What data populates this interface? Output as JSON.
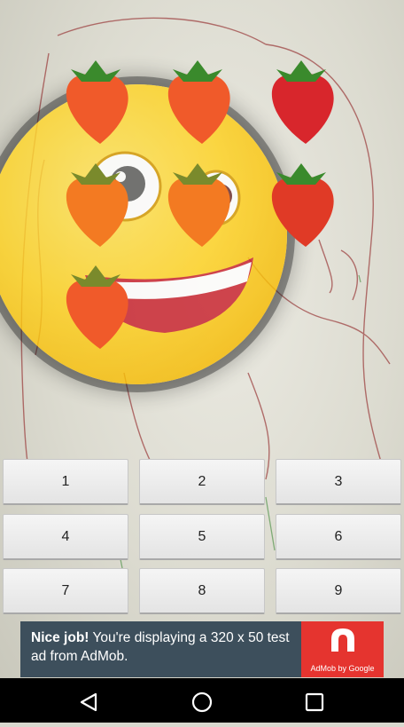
{
  "keypad": [
    "1",
    "2",
    "3",
    "4",
    "5",
    "6",
    "7",
    "8",
    "9"
  ],
  "ad": {
    "headline": "Nice job!",
    "body": "You're displaying a 320 x 50 test ad from AdMob.",
    "brand": "AdMob by Google",
    "brand_color": "#e5342f",
    "background_color": "#3d4f5c"
  },
  "grid": {
    "fruit": "strawberry",
    "count": 7,
    "overlay": "smiling-emoji-lens"
  },
  "navigation": {
    "back": "back-icon",
    "home": "home-icon",
    "recents": "recents-icon"
  }
}
